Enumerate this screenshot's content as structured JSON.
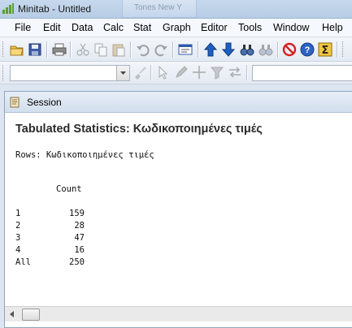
{
  "window": {
    "title": "Minitab - Untitled",
    "ghost_tab": "Tones New Y"
  },
  "menu": [
    "File",
    "Edit",
    "Data",
    "Calc",
    "Stat",
    "Graph",
    "Editor",
    "Tools",
    "Window",
    "Help"
  ],
  "toolbar1_icons": [
    "open-folder-icon",
    "save-icon",
    "print-icon",
    "cut-icon",
    "copy-icon",
    "paste-icon",
    "undo-icon",
    "redo-icon",
    "session-window-icon",
    "arrow-up-icon",
    "arrow-down-icon",
    "find-icon",
    "replace-icon",
    "cancel-icon",
    "help-icon",
    "sigma-icon"
  ],
  "toolbar2_icons": [
    "brush-icon",
    "select-arrow-icon",
    "pen-icon",
    "crosshair-icon",
    "flag-icon",
    "swap-arrows-icon"
  ],
  "toolbar2": {
    "dropdown_value": "",
    "input_value": ""
  },
  "session": {
    "title": "Session",
    "heading": "Tabulated Statistics: Κωδικοποιημένες τιμές",
    "rows_label": "Rows: Κωδικοποιημένες τιμές",
    "count_header": "Count",
    "rows": [
      {
        "label": "1",
        "count": "159"
      },
      {
        "label": "2",
        "count": "28"
      },
      {
        "label": "3",
        "count": "47"
      },
      {
        "label": "4",
        "count": "16"
      },
      {
        "label": "All",
        "count": "250"
      }
    ]
  },
  "colors": {
    "title_bar": "#b7cde6",
    "menu_bar": "#f5f8fc",
    "accent_blue": "#1f5fbf",
    "cancel_red": "#d42020",
    "sigma_bg": "#f2c640"
  }
}
